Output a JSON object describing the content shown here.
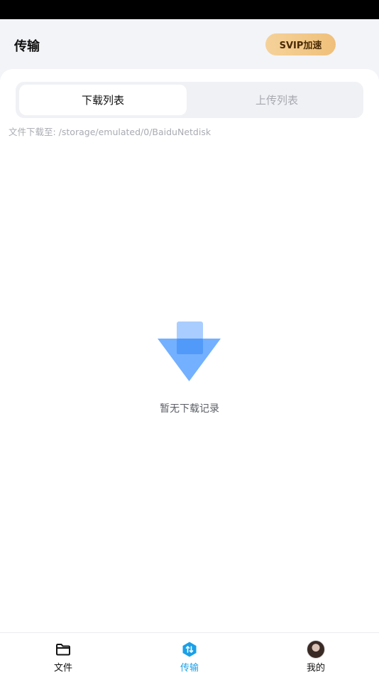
{
  "header": {
    "title": "传输",
    "svip_label": "SVIP加速"
  },
  "tabs": {
    "download": "下载列表",
    "upload": "上传列表"
  },
  "download_path": "文件下载至: /storage/emulated/0/BaiduNetdisk",
  "empty_state": {
    "icon": "download-arrow-icon",
    "message": "暂无下载记录"
  },
  "bottom_nav": {
    "files": {
      "label": "文件",
      "icon": "folder-icon"
    },
    "transfer": {
      "label": "传输",
      "icon": "transfer-icon",
      "active": true
    },
    "me": {
      "label": "我的",
      "icon": "avatar"
    }
  },
  "colors": {
    "accent": "#1aa0e8",
    "svip_gradient_start": "#f5d29a",
    "svip_gradient_end": "#efc07a",
    "empty_icon_blue": "#5aa2ff"
  }
}
